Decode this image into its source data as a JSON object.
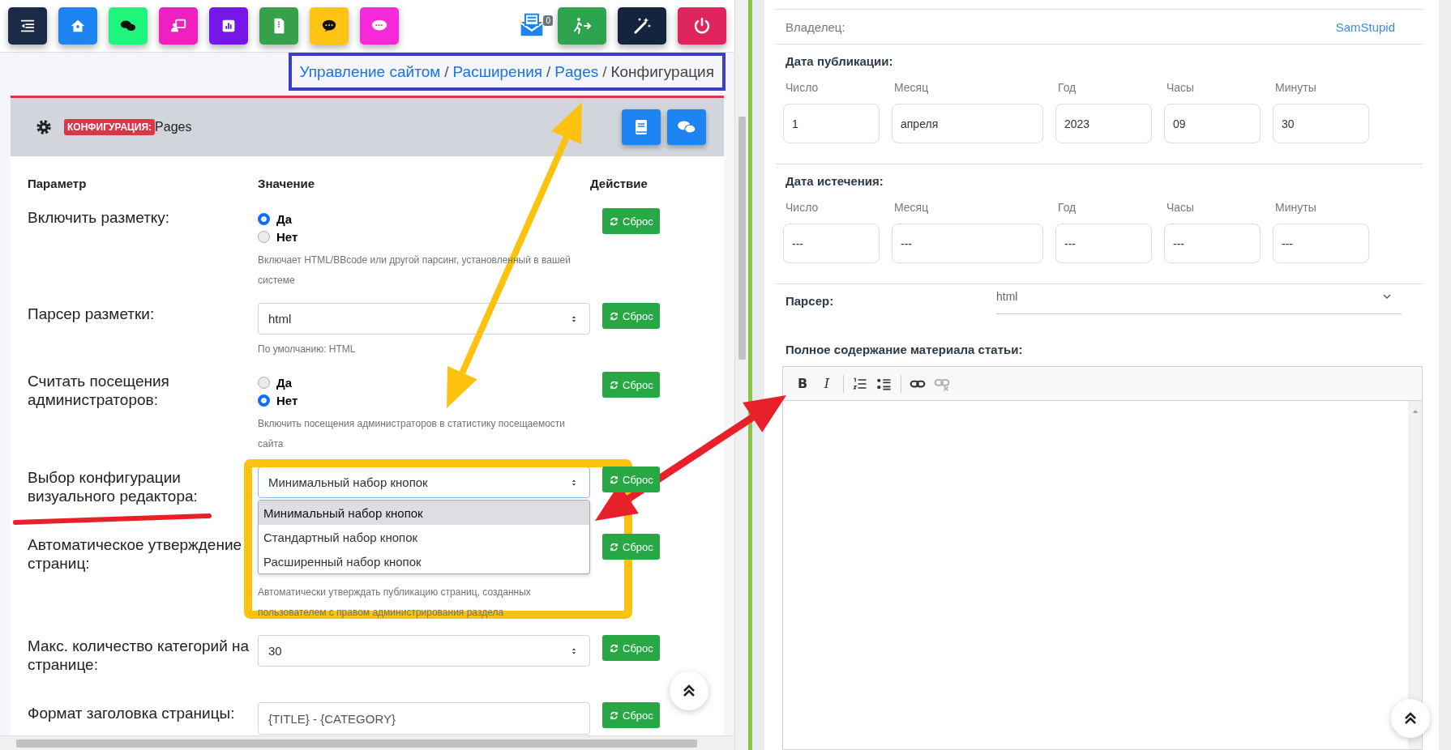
{
  "toolbar": {
    "buttons": [
      {
        "kind": "menu",
        "color": "#1b2a47"
      },
      {
        "kind": "home",
        "color": "#1d84f2"
      },
      {
        "kind": "chat",
        "color": "#1ff57a"
      },
      {
        "kind": "presentation",
        "color": "#f01fbf"
      },
      {
        "kind": "chart",
        "color": "#7417e8"
      },
      {
        "kind": "file",
        "color": "#36a04a"
      },
      {
        "kind": "comment",
        "color": "#ffc414"
      },
      {
        "kind": "sms",
        "color": "#f72ad9"
      }
    ],
    "mail": {
      "count": "0"
    },
    "right_buttons": [
      {
        "kind": "exit",
        "color": "#2ea44f"
      },
      {
        "kind": "magic",
        "color": "#15243d"
      },
      {
        "kind": "power",
        "color": "#e0245e"
      }
    ]
  },
  "breadcrumb": [
    {
      "kind": "link",
      "label": "Управление сайтом"
    },
    {
      "kind": "separator",
      "label": "/"
    },
    {
      "kind": "link",
      "label": "Расширения"
    },
    {
      "kind": "separator",
      "label": "/"
    },
    {
      "kind": "link",
      "label": "Pages"
    },
    {
      "kind": "separator",
      "label": "/"
    },
    {
      "kind": "current",
      "label": "Конфигурация"
    }
  ],
  "card": {
    "badge": "КОНФИГУРАЦИЯ:",
    "title": "Pages",
    "buttons": [
      {
        "kind": "book"
      },
      {
        "kind": "chat"
      }
    ]
  },
  "table": {
    "columns": [
      "Параметр",
      "Значение",
      "Действие"
    ],
    "rows": [
      {
        "label": "Включить разметку:",
        "kind": "radio",
        "options": [
          {
            "label": "Да",
            "selected": true
          },
          {
            "label": "Нет",
            "selected": false
          }
        ],
        "hint": "Включает HTML/BBcode или другой парсинг, установленный в вашей системе",
        "action": "Сброс"
      },
      {
        "label": "Парсер разметки:",
        "kind": "select",
        "value": "html",
        "hint": "По умолчанию: HTML",
        "action": "Сброс"
      },
      {
        "label": "Считать посещения администраторов:",
        "kind": "radio",
        "options": [
          {
            "label": "Да",
            "selected": false
          },
          {
            "label": "Нет",
            "selected": true
          }
        ],
        "hint": "Включить посещения администраторов в статистику посещаемости сайта",
        "action": "Сброс"
      },
      {
        "label": "Выбор конфигурации визуального редактора:",
        "kind": "select",
        "value": "Минимальный набор кнопок",
        "expanded": true,
        "options": [
          {
            "label": "Минимальный набор кнопок",
            "selected": true
          },
          {
            "label": "Стандартный набор кнопок",
            "selected": false
          },
          {
            "label": "Расширенный набор кнопок",
            "selected": false
          }
        ],
        "action": "Сброс"
      },
      {
        "label": "Автоматическое утверждение страниц:",
        "kind": "hidden",
        "hint": "Автоматически утверждать публикацию страниц, созданных пользователем с правом администрирования раздела",
        "action": "Сброс"
      },
      {
        "label": "Макс. количество категорий на странице:",
        "kind": "select",
        "value": "30",
        "action": "Сброс"
      },
      {
        "label": "Формат заголовка страницы:",
        "kind": "input",
        "value": "{TITLE} - {CATEGORY}",
        "action": "Сброс"
      }
    ]
  },
  "editor_form": {
    "owner": {
      "label": "Владелец:",
      "value": "SamStupid"
    },
    "dates": [
      {
        "title": "Дата публикации:",
        "fields": [
          {
            "label": "Число",
            "value": "1"
          },
          {
            "label": "Месяц",
            "value": "апреля"
          },
          {
            "label": "Год",
            "value": "2023"
          },
          {
            "label": "Часы",
            "value": "09"
          },
          {
            "label": "Минуты",
            "value": "30"
          }
        ]
      },
      {
        "title": "Дата истечения:",
        "fields": [
          {
            "label": "Число",
            "value": "---"
          },
          {
            "label": "Месяц",
            "value": "---"
          },
          {
            "label": "Год",
            "value": "---"
          },
          {
            "label": "Часы",
            "value": "---"
          },
          {
            "label": "Минуты",
            "value": "---"
          }
        ]
      }
    ],
    "parser": {
      "label": "Парсер:",
      "value": "html"
    },
    "content": {
      "label": "Полное содержание материала статьи:",
      "tools": [
        {
          "kind": "bold",
          "label": "B",
          "disabled": false
        },
        {
          "kind": "italic",
          "label": "I",
          "disabled": false
        },
        {
          "kind": "ordered-list",
          "disabled": false
        },
        {
          "kind": "bullet-list",
          "disabled": false
        },
        {
          "kind": "link",
          "disabled": false
        },
        {
          "kind": "unlink",
          "disabled": true
        }
      ]
    }
  }
}
